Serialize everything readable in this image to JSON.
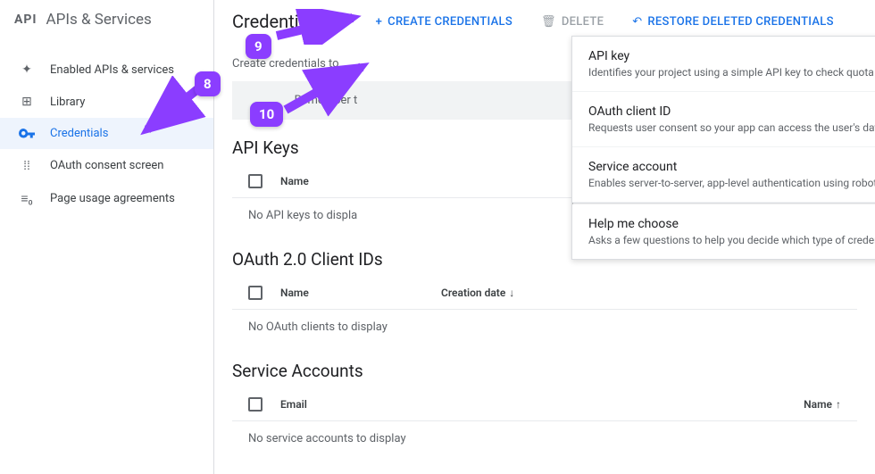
{
  "sidebar": {
    "title": "APIs & Services",
    "items": [
      {
        "label": "Enabled APIs & services"
      },
      {
        "label": "Library"
      },
      {
        "label": "Credentials"
      },
      {
        "label": "OAuth consent screen"
      },
      {
        "label": "Page usage agreements"
      }
    ]
  },
  "toolbar": {
    "page_title": "Credentials",
    "create": "CREATE CREDENTIALS",
    "delete": "DELETE",
    "restore": "RESTORE DELETED CREDENTIALS"
  },
  "subtext": "Create credentials to",
  "remember_banner": "Remember t",
  "dropdown": {
    "items": [
      {
        "title": "API key",
        "desc": "Identifies your project using a simple API key to check quota and access"
      },
      {
        "title": "OAuth client ID",
        "desc": "Requests user consent so your app can access the user's data"
      },
      {
        "title": "Service account",
        "desc": "Enables server-to-server, app-level authentication using robot accounts"
      },
      {
        "title": "Help me choose",
        "desc": "Asks a few questions to help you decide which type of credential to use"
      }
    ]
  },
  "sections": {
    "api_keys": {
      "title": "API Keys",
      "col_name": "Name",
      "empty": "No API keys to displa"
    },
    "oauth_clients": {
      "title": "OAuth 2.0 Client IDs",
      "col_name": "Name",
      "col_creation": "Creation date",
      "empty": "No OAuth clients to display"
    },
    "service_accounts": {
      "title": "Service Accounts",
      "col_email": "Email",
      "col_name": "Name",
      "empty": "No service accounts to display"
    }
  },
  "callouts": {
    "c8": "8",
    "c9": "9",
    "c10": "10"
  }
}
